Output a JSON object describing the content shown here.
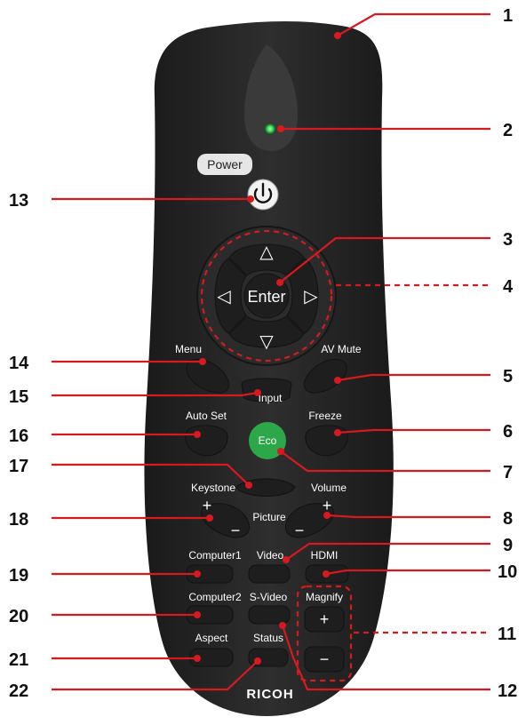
{
  "remote": {
    "brand": "RICOH",
    "labels": {
      "power": "Power",
      "enter": "Enter",
      "menu": "Menu",
      "av_mute": "AV Mute",
      "input": "Input",
      "auto_set": "Auto Set",
      "freeze": "Freeze",
      "eco": "Eco",
      "keystone": "Keystone",
      "volume": "Volume",
      "picture": "Picture",
      "computer1": "Computer1",
      "video": "Video",
      "hdmi": "HDMI",
      "computer2": "Computer2",
      "s_video": "S-Video",
      "magnify": "Magnify",
      "aspect": "Aspect",
      "status": "Status",
      "plus": "+",
      "minus": "−",
      "arrow_up": "△",
      "arrow_down": "▽",
      "arrow_left": "◁",
      "arrow_right": "▷"
    },
    "callouts": [
      "1",
      "2",
      "3",
      "4",
      "5",
      "6",
      "7",
      "8",
      "9",
      "10",
      "11",
      "12",
      "13",
      "14",
      "15",
      "16",
      "17",
      "18",
      "19",
      "20",
      "21",
      "22"
    ]
  },
  "colors": {
    "body": "#262626",
    "button": "#1e1e1e",
    "eco": "#2ca84a",
    "leader": "#d71920",
    "led": "#3ddc5a"
  }
}
